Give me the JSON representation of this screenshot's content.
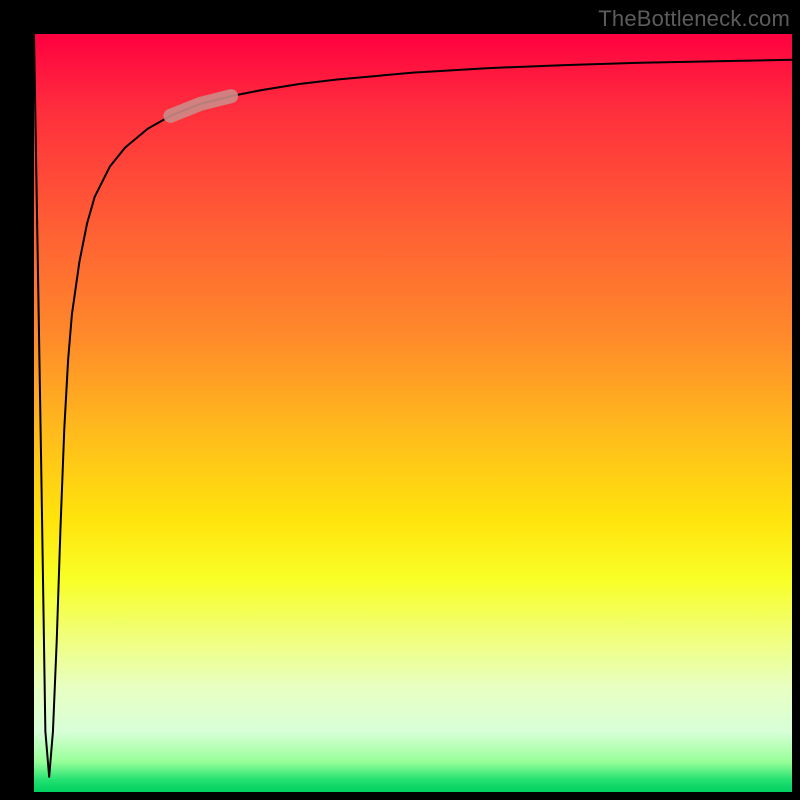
{
  "watermark": "TheBottleneck.com",
  "chart_data": {
    "type": "line",
    "title": "",
    "xlabel": "",
    "ylabel": "",
    "xlim": [
      0,
      100
    ],
    "ylim": [
      0,
      100
    ],
    "grid": false,
    "legend": null,
    "series": [
      {
        "name": "bottleneck-curve",
        "x": [
          0.0,
          1.0,
          1.5,
          2.0,
          2.5,
          3.0,
          3.5,
          4.0,
          4.5,
          5.0,
          6.0,
          7.0,
          8.0,
          10.0,
          12.0,
          15.0,
          18.0,
          22.0,
          26.0,
          30.0,
          35.0,
          40.0,
          50.0,
          60.0,
          70.0,
          80.0,
          90.0,
          100.0
        ],
        "y": [
          100.0,
          40.0,
          8.0,
          2.0,
          8.0,
          20.0,
          35.0,
          48.0,
          57.0,
          63.0,
          70.0,
          75.0,
          78.5,
          82.5,
          85.0,
          87.5,
          89.2,
          90.8,
          91.8,
          92.6,
          93.4,
          94.0,
          94.9,
          95.5,
          95.9,
          96.2,
          96.4,
          96.6
        ]
      }
    ],
    "highlight": {
      "name": "highlight-segment",
      "x_range": [
        18.0,
        26.0
      ],
      "color": "#cc8b86"
    },
    "gradient_stops": [
      {
        "pos": 0.0,
        "color": "#ff0040"
      },
      {
        "pos": 0.5,
        "color": "#ffb91d"
      },
      {
        "pos": 0.72,
        "color": "#f8ff26"
      },
      {
        "pos": 0.96,
        "color": "#98ff98"
      },
      {
        "pos": 1.0,
        "color": "#00d060"
      }
    ]
  }
}
